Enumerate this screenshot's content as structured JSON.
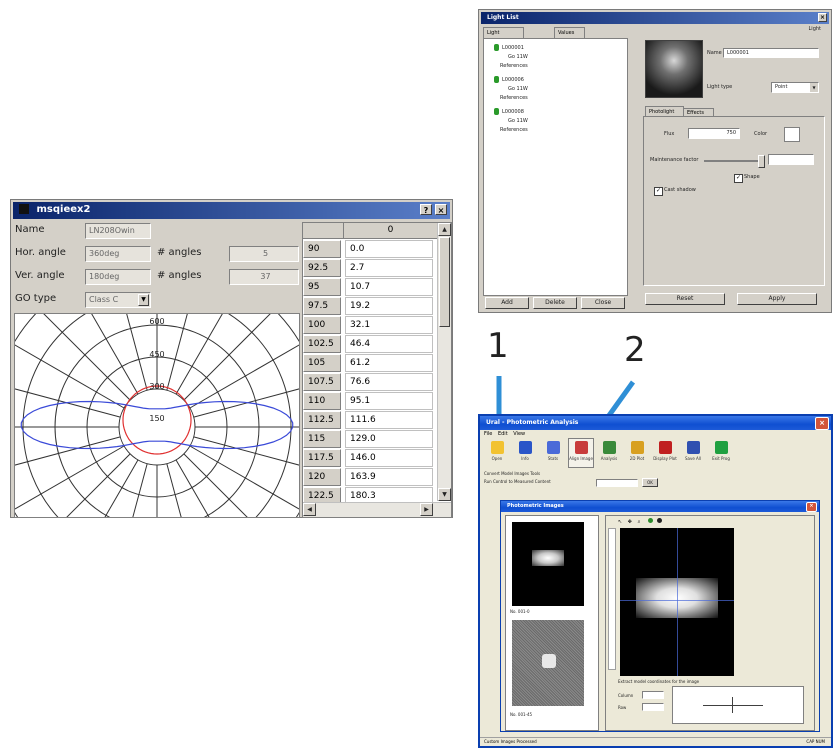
{
  "photometric_window": {
    "title": "msqieex2",
    "rows": [
      {
        "label": "Name",
        "value": "LN208Owin"
      },
      {
        "label": "Hor. angle",
        "value": "360deg",
        "count_label": "# angles",
        "count": "5"
      },
      {
        "label": "Ver. angle",
        "value": "180deg",
        "count_label": "# angles",
        "count": "37"
      },
      {
        "label": "GO type",
        "value": "Class C"
      }
    ],
    "table_header": "0",
    "table": [
      {
        "angle": "90",
        "value": "0.0"
      },
      {
        "angle": "92.5",
        "value": "2.7"
      },
      {
        "angle": "95",
        "value": "10.7"
      },
      {
        "angle": "97.5",
        "value": "19.2"
      },
      {
        "angle": "100",
        "value": "32.1"
      },
      {
        "angle": "102.5",
        "value": "46.4"
      },
      {
        "angle": "105",
        "value": "61.2"
      },
      {
        "angle": "107.5",
        "value": "76.6"
      },
      {
        "angle": "110",
        "value": "95.1"
      },
      {
        "angle": "112.5",
        "value": "111.6"
      },
      {
        "angle": "115",
        "value": "129.0"
      },
      {
        "angle": "117.5",
        "value": "146.0"
      },
      {
        "angle": "120",
        "value": "163.9"
      },
      {
        "angle": "122.5",
        "value": "180.3"
      }
    ],
    "polar_labels": [
      "600",
      "450",
      "300",
      "150"
    ]
  },
  "light_list_window": {
    "title": "Light List",
    "tabs": [
      "Light",
      "Values"
    ],
    "tree": [
      {
        "name": "L000001",
        "child": "Go 11W",
        "ref": "References"
      },
      {
        "name": "L000006",
        "child": "Go 11W",
        "ref": "References"
      },
      {
        "name": "L000008",
        "child": "Go 11W",
        "ref": "References"
      }
    ],
    "bottom_buttons": [
      "Add",
      "Delete",
      "Close"
    ],
    "name_label": "Name",
    "name_value": "L000001",
    "light_type_label": "Light type",
    "light_type_value": "Point",
    "prop_tabs": [
      "Photolight",
      "Effects"
    ],
    "flux_label": "Flux",
    "flux_value": "750",
    "color_label": "Color",
    "maintenance_label": "Maintenance factor",
    "shape_label": "Shape",
    "cast_shadow_label": "Cast shadow",
    "action_buttons": [
      "Reset",
      "Apply"
    ]
  },
  "annotations": {
    "number_1": "1",
    "number_2": "2"
  },
  "analysis_window": {
    "title": "Ural - Photometric Analysis",
    "menu": [
      "File",
      "Edit",
      "View"
    ],
    "toolbar": [
      {
        "label": "Open",
        "icon": "folder-icon",
        "color": "#f2c230"
      },
      {
        "label": "Info",
        "icon": "info-icon",
        "color": "#2a55c8"
      },
      {
        "label": "Stats",
        "icon": "stats-icon",
        "color": "#4a6ad8"
      },
      {
        "label": "Align Image",
        "icon": "align-image-icon",
        "color": "#c83c3c"
      },
      {
        "label": "Analysis",
        "icon": "chart-icon",
        "color": "#3a8a3a"
      },
      {
        "label": "2D Plot",
        "icon": "plot-icon",
        "color": "#d8a020"
      },
      {
        "label": "Display Plot",
        "icon": "globe-icon",
        "color": "#c02020"
      },
      {
        "label": "Save All",
        "icon": "save-icon",
        "color": "#3050b0"
      },
      {
        "label": "Exit Prog",
        "icon": "exit-icon",
        "color": "#20a040"
      }
    ],
    "option_lines": [
      "Convert Model Images Tools",
      "Run Control to Measured Content"
    ],
    "ok_label": "OK",
    "sub_title": "Photometric Images",
    "thumb_captions": [
      "No. 001-0",
      "No. 001-45"
    ],
    "status_label": "Extract model coordinates for the image",
    "fields": [
      {
        "label": "Column"
      },
      {
        "label": "Row"
      }
    ],
    "status_left": "Custom Images Processed",
    "status_right": "CAP NUM"
  }
}
